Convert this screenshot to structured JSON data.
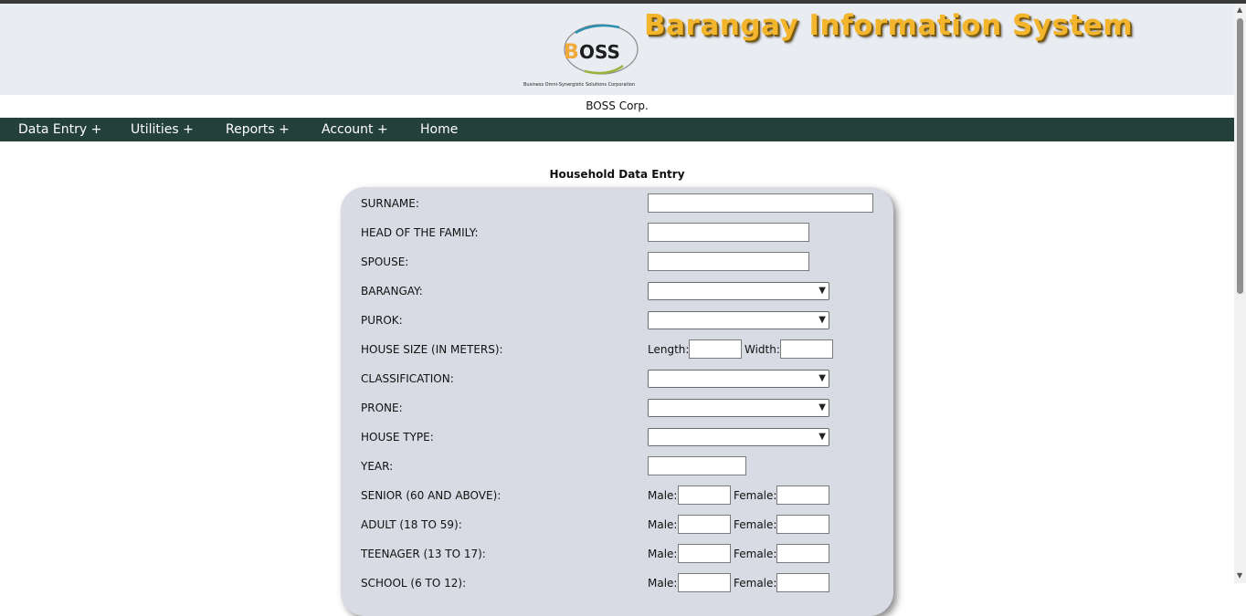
{
  "header": {
    "logo_text": "BOSS",
    "logo_tagline": "Business Omni-Synergistic Solutions Corporation",
    "system_title": "Barangay Information System",
    "corp_name": "BOSS Corp."
  },
  "nav": {
    "items": [
      {
        "label": "Data Entry +"
      },
      {
        "label": "Utilities +"
      },
      {
        "label": "Reports +"
      },
      {
        "label": "Account +"
      },
      {
        "label": "Home"
      }
    ]
  },
  "form": {
    "title": "Household Data Entry",
    "surname": {
      "label": "SURNAME:",
      "value": ""
    },
    "head": {
      "label": "HEAD OF THE FAMILY:",
      "value": ""
    },
    "spouse": {
      "label": "SPOUSE:",
      "value": ""
    },
    "barangay": {
      "label": "BARANGAY:",
      "selected": ""
    },
    "purok": {
      "label": "PUROK:",
      "selected": ""
    },
    "house_size": {
      "label": "HOUSE SIZE (IN METERS):",
      "length_label": "Length:",
      "width_label": "Width:"
    },
    "classification": {
      "label": "CLASSIFICATION:",
      "selected": ""
    },
    "prone": {
      "label": "PRONE:",
      "selected": ""
    },
    "house_type": {
      "label": "HOUSE TYPE:",
      "selected": ""
    },
    "year": {
      "label": "YEAR:",
      "value": ""
    },
    "senior": {
      "label": "SENIOR (60 AND ABOVE):"
    },
    "adult": {
      "label": "ADULT (18 TO 59):"
    },
    "teenager": {
      "label": "TEENAGER (13 TO 17):"
    },
    "school": {
      "label": "SCHOOL (6 TO 12):"
    },
    "male_label": "Male:",
    "female_label": "Female:"
  },
  "colors": {
    "nav_bg": "#23403b",
    "header_bg": "#e9ecf1",
    "title_gold": "#f2b52c",
    "panel_bg": "#d8dbe3"
  }
}
